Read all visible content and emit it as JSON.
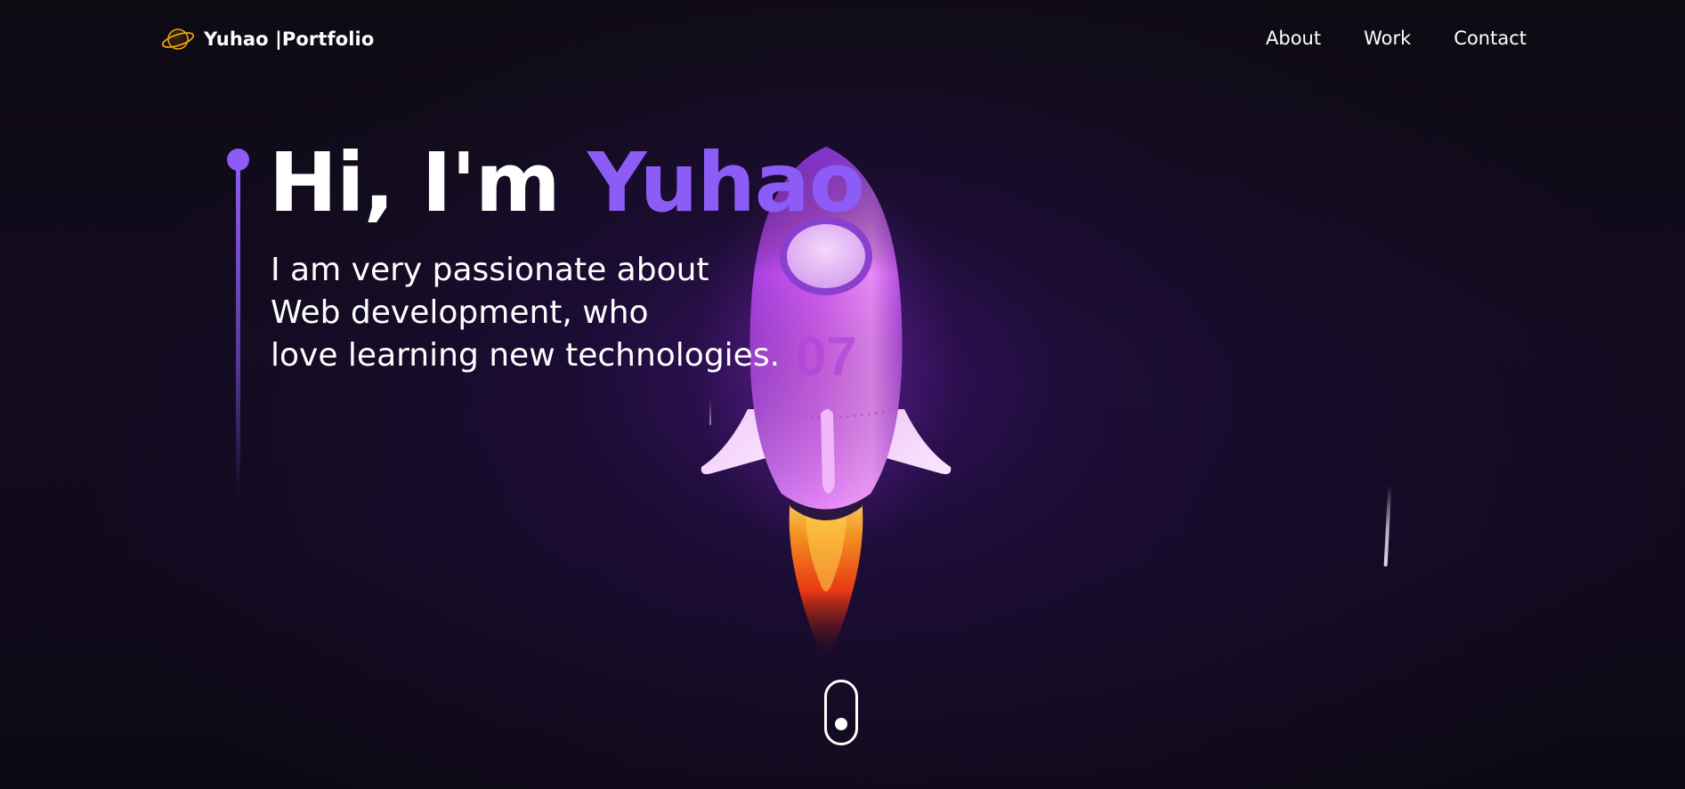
{
  "header": {
    "brand_text": "Yuhao |Portfolio",
    "nav": [
      {
        "label": "About"
      },
      {
        "label": "Work"
      },
      {
        "label": "Contact"
      }
    ]
  },
  "hero": {
    "greeting": "Hi, I'm",
    "name": "Yuhao",
    "description_lines": [
      "I am very passionate about",
      "Web development, who",
      "love learning new technologies."
    ],
    "rocket_number": "07"
  },
  "colors": {
    "accent": "#8d5cf6",
    "background": "#0e0b13",
    "text": "#ffffff",
    "rocket_body": "#d24cf0",
    "logo_orange": "#f2a20c"
  },
  "icons": {
    "logo": "planet-icon",
    "scroll": "scroll-mouse-icon",
    "illustration": "rocket-icon"
  }
}
